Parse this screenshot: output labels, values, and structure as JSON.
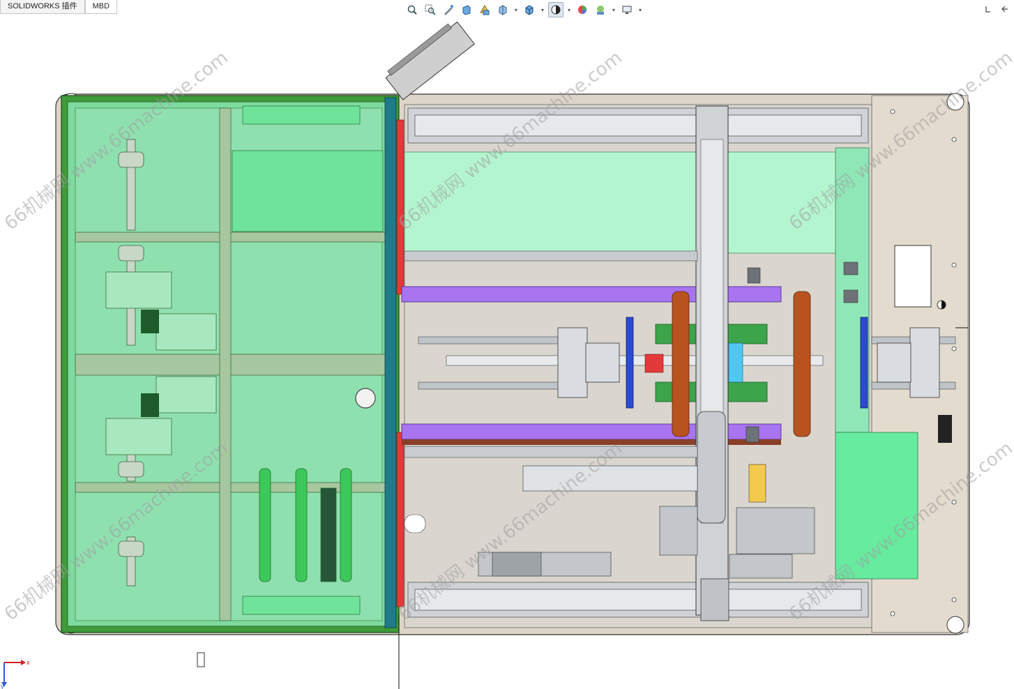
{
  "tabs": [
    {
      "label": "SOLIDWORKS 插件",
      "active": false
    },
    {
      "label": "MBD",
      "active": true
    }
  ],
  "toolbar": [
    {
      "icon": "zoom-to-fit-icon"
    },
    {
      "icon": "zoom-area-icon"
    },
    {
      "icon": "previous-view-icon"
    },
    {
      "icon": "section-view-icon"
    },
    {
      "icon": "dynamic-annotation-icon"
    },
    {
      "icon": "view-orientation-icon",
      "dropdown": true
    },
    {
      "icon": "display-style-icon",
      "dropdown": true
    },
    {
      "icon": "hide-show-items-icon",
      "dropdown": true,
      "pressed": true
    },
    {
      "icon": "edit-appearance-icon"
    },
    {
      "icon": "apply-scene-icon",
      "dropdown": true
    },
    {
      "icon": "view-settings-icon",
      "dropdown": true
    }
  ],
  "watermark": "66机械网 www.66machine.com",
  "triad": {
    "x_label": "x",
    "y_label": "y"
  },
  "colors": {
    "enclosure_green": "#7ddba0",
    "frame_green": "#3f9a3a",
    "deck_gray": "#dad6cf",
    "base_tan": "#ddd5c8",
    "mint_panel": "#b3f5cf",
    "purple_rail": "#a874f0",
    "copper_wheel": "#b8531f",
    "blue_block": "#2b4bd1",
    "red_edge": "#e23a3a",
    "teal_bar": "#1e7b8c"
  }
}
